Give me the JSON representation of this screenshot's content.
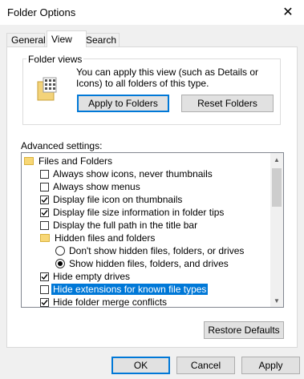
{
  "window": {
    "title": "Folder Options",
    "close_glyph": "✕"
  },
  "tabs": [
    {
      "label": "General",
      "active": false
    },
    {
      "label": "View",
      "active": true
    },
    {
      "label": "Search",
      "active": false
    }
  ],
  "folder_views": {
    "group_label": "Folder views",
    "description": "You can apply this view (such as Details or Icons) to all folders of this type.",
    "apply_button": "Apply to Folders",
    "reset_button": "Reset Folders"
  },
  "advanced": {
    "label": "Advanced settings:",
    "items": [
      {
        "type": "folder",
        "label": "Files and Folders"
      },
      {
        "type": "checkbox",
        "label": "Always show icons, never thumbnails",
        "checked": false
      },
      {
        "type": "checkbox",
        "label": "Always show menus",
        "checked": false
      },
      {
        "type": "checkbox",
        "label": "Display file icon on thumbnails",
        "checked": true
      },
      {
        "type": "checkbox",
        "label": "Display file size information in folder tips",
        "checked": true
      },
      {
        "type": "checkbox",
        "label": "Display the full path in the title bar",
        "checked": false
      },
      {
        "type": "folder",
        "label": "Hidden files and folders"
      },
      {
        "type": "radio",
        "label": "Don't show hidden files, folders, or drives",
        "checked": false
      },
      {
        "type": "radio",
        "label": "Show hidden files, folders, and drives",
        "checked": true
      },
      {
        "type": "checkbox",
        "label": "Hide empty drives",
        "checked": true
      },
      {
        "type": "checkbox",
        "label": "Hide extensions for known file types",
        "checked": false,
        "selected": true
      },
      {
        "type": "checkbox",
        "label": "Hide folder merge conflicts",
        "checked": true
      }
    ]
  },
  "restore_button": "Restore Defaults",
  "footer": {
    "ok": "OK",
    "cancel": "Cancel",
    "apply": "Apply"
  },
  "colors": {
    "selection": "#0078d7",
    "folder": "#f8d775"
  }
}
